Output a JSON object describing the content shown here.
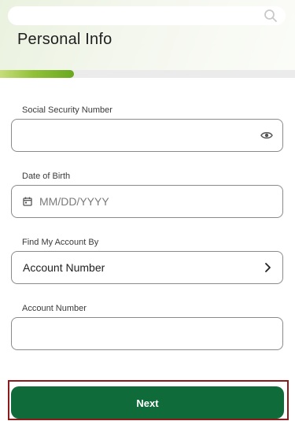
{
  "header": {
    "title": "Personal Info",
    "search_icon": "search-icon"
  },
  "progress": {
    "fraction": 0.25,
    "accent": "#7ab52f"
  },
  "form": {
    "ssn": {
      "label": "Social Security Number",
      "value": "",
      "toggle_icon": "eye-icon"
    },
    "dob": {
      "label": "Date of Birth",
      "placeholder": "MM/DD/YYYY",
      "icon": "calendar-icon"
    },
    "find_by": {
      "label": "Find My Account By",
      "value": "Account Number",
      "icon": "chevron-right-icon"
    },
    "account_number": {
      "label": "Account Number",
      "value": ""
    }
  },
  "actions": {
    "next_label": "Next",
    "next_color": "#0f6b3a"
  }
}
